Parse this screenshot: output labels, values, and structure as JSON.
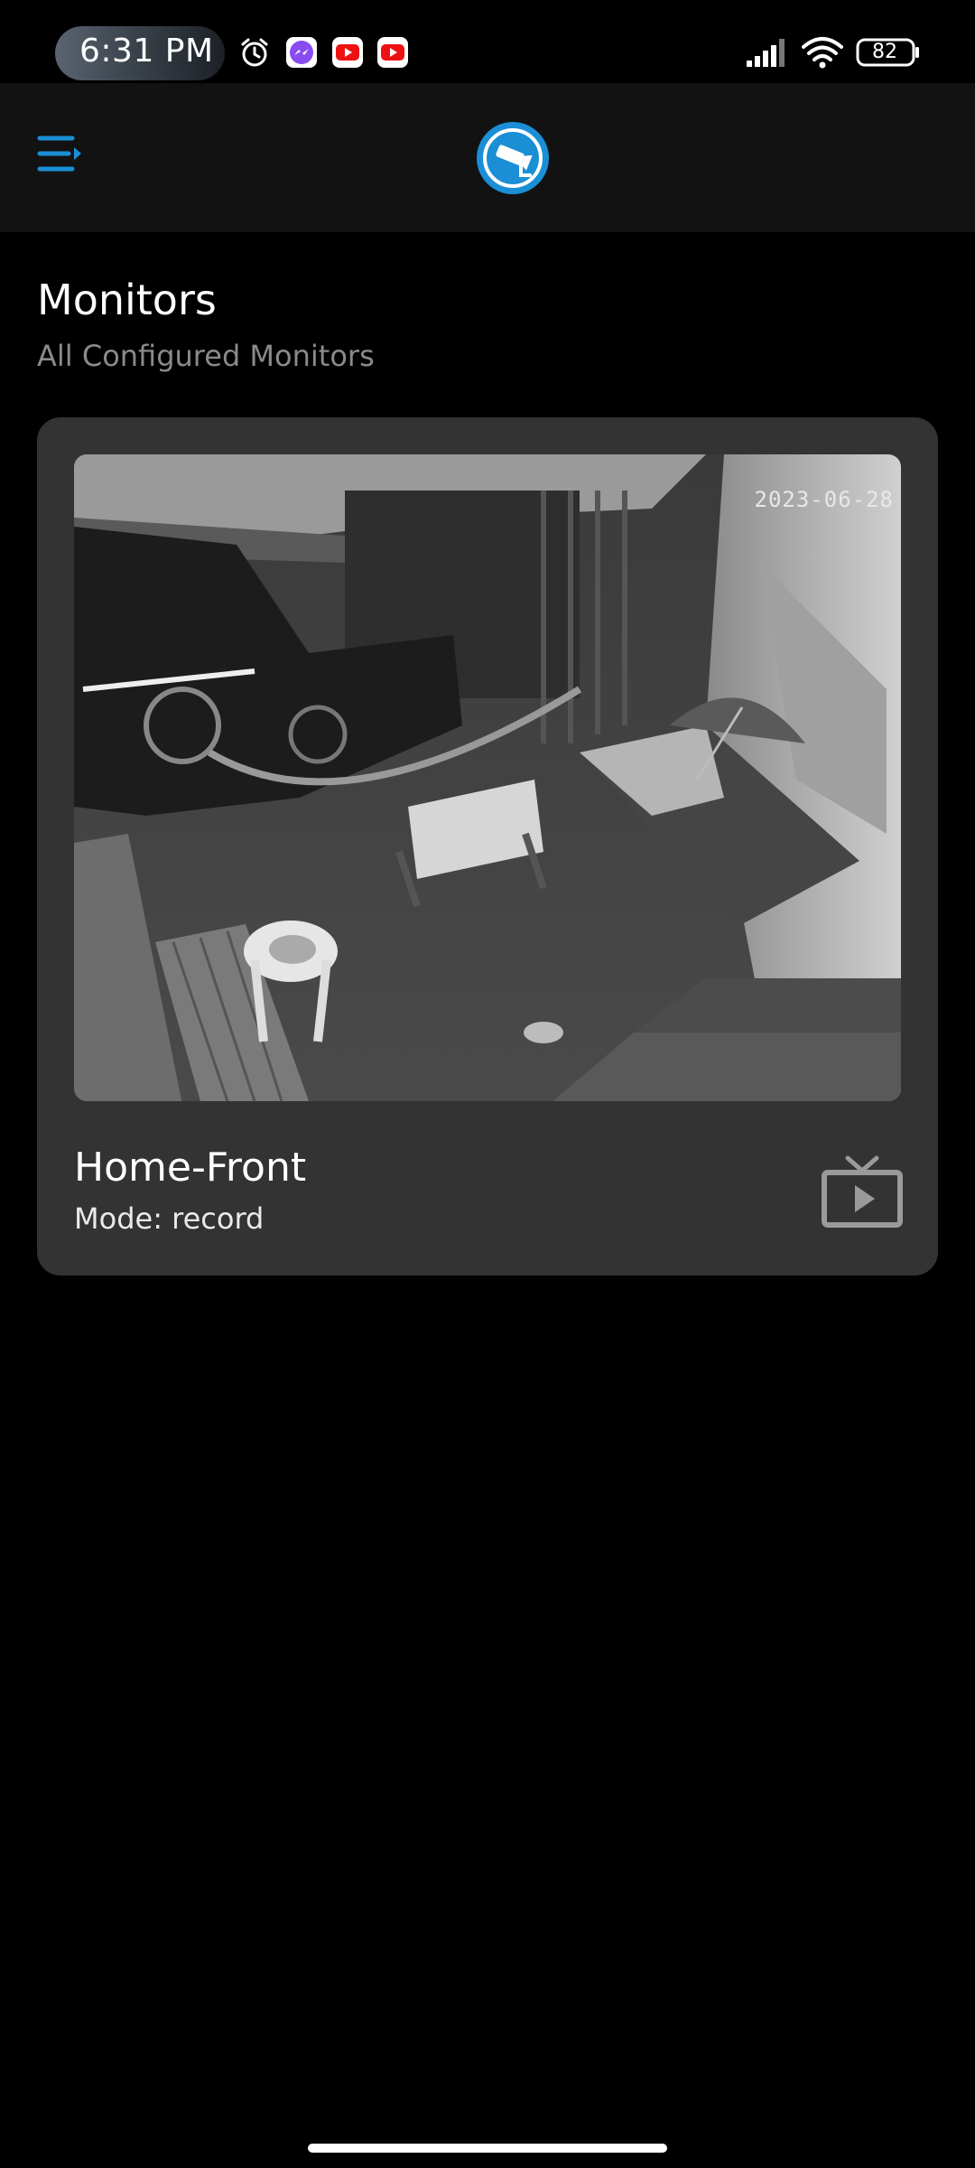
{
  "status_bar": {
    "time": "6:31 PM",
    "battery_level": "82",
    "notification_icons": [
      "alarm-icon",
      "messenger-icon",
      "youtube-icon",
      "youtube-icon"
    ],
    "right_icons": [
      "signal-icon",
      "wifi-icon",
      "battery-icon"
    ]
  },
  "app_bar": {
    "menu_icon": "menu-icon",
    "logo_icon": "security-camera-icon",
    "accent_color": "#1a8fd6"
  },
  "page": {
    "title": "Monitors",
    "subtitle": "All Configured Monitors"
  },
  "monitors": [
    {
      "name": "Home-Front",
      "mode": "Mode: record",
      "snapshot_timestamp": "2023-06-28",
      "action_icon": "live-tv-icon"
    }
  ]
}
